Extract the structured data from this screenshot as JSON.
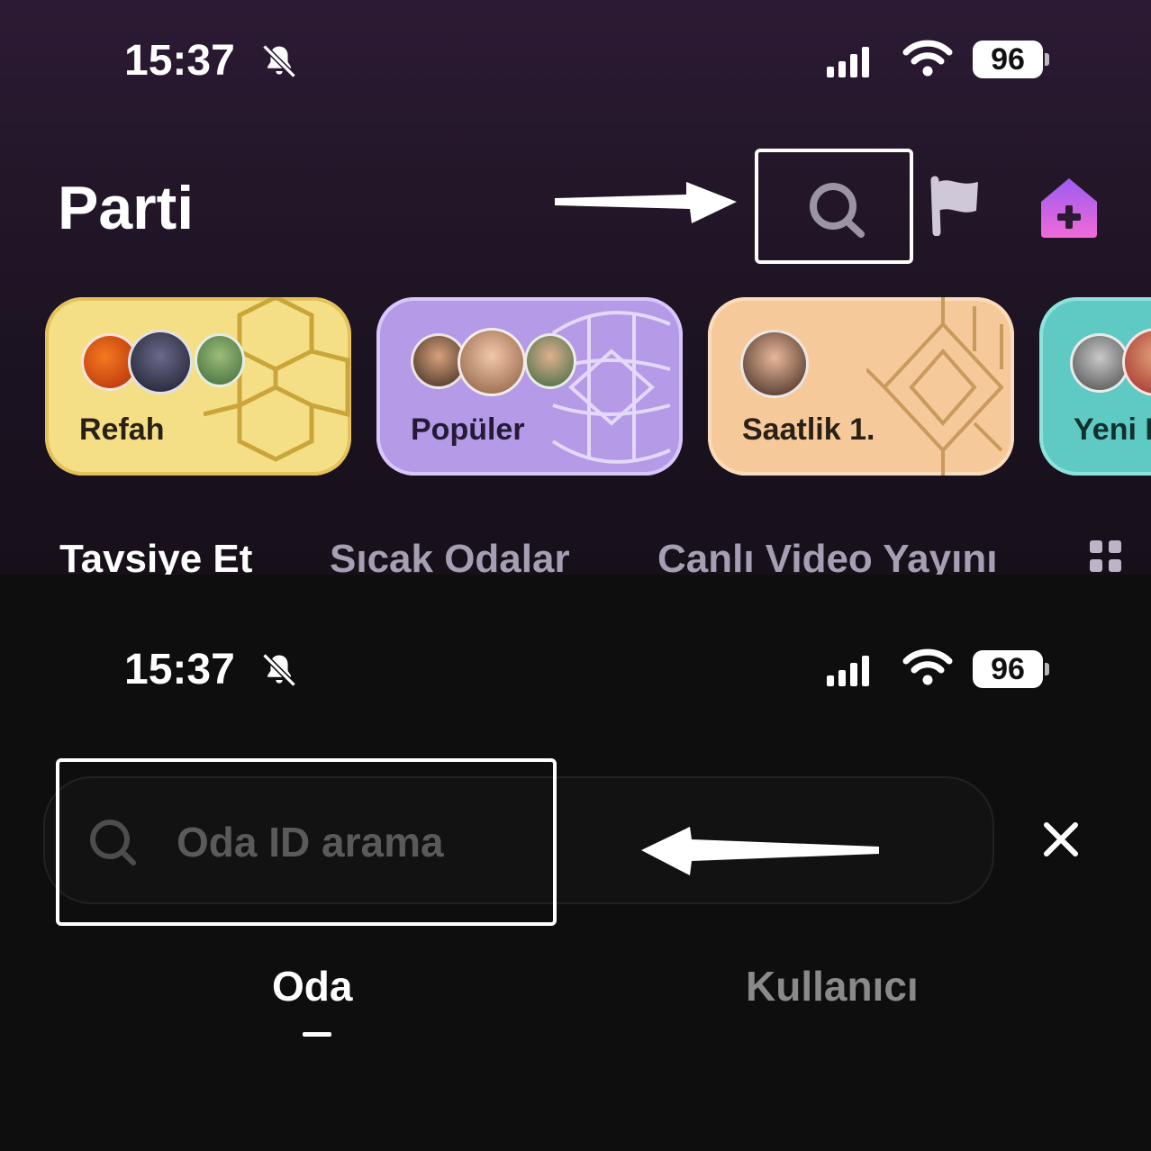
{
  "top_screen": {
    "status": {
      "time": "15:37",
      "battery": "96",
      "bell": "bell-slash-icon"
    },
    "title": "Parti",
    "icons": [
      "search-icon",
      "flag-icon",
      "add-room-icon"
    ],
    "cards": [
      {
        "label": "Refah",
        "color": "#f6e08a"
      },
      {
        "label": "Popüler",
        "color": "#b59ae8"
      },
      {
        "label": "Saatlik 1.",
        "color": "#f6c99a"
      },
      {
        "label": "Yeni K",
        "color": "#5fcac4"
      }
    ],
    "tabs": [
      {
        "label": "Tavsiye Et",
        "active": true
      },
      {
        "label": "Sıcak Odalar",
        "active": false
      },
      {
        "label": "Canlı Video Yayını",
        "active": false
      }
    ]
  },
  "bottom_screen": {
    "status": {
      "time": "15:37",
      "battery": "96",
      "bell": "bell-slash-icon"
    },
    "search": {
      "placeholder": "Oda ID arama"
    },
    "close_icon": "close-icon",
    "segments": [
      {
        "label": "Oda",
        "active": true
      },
      {
        "label": "Kullanıcı",
        "active": false
      }
    ]
  }
}
